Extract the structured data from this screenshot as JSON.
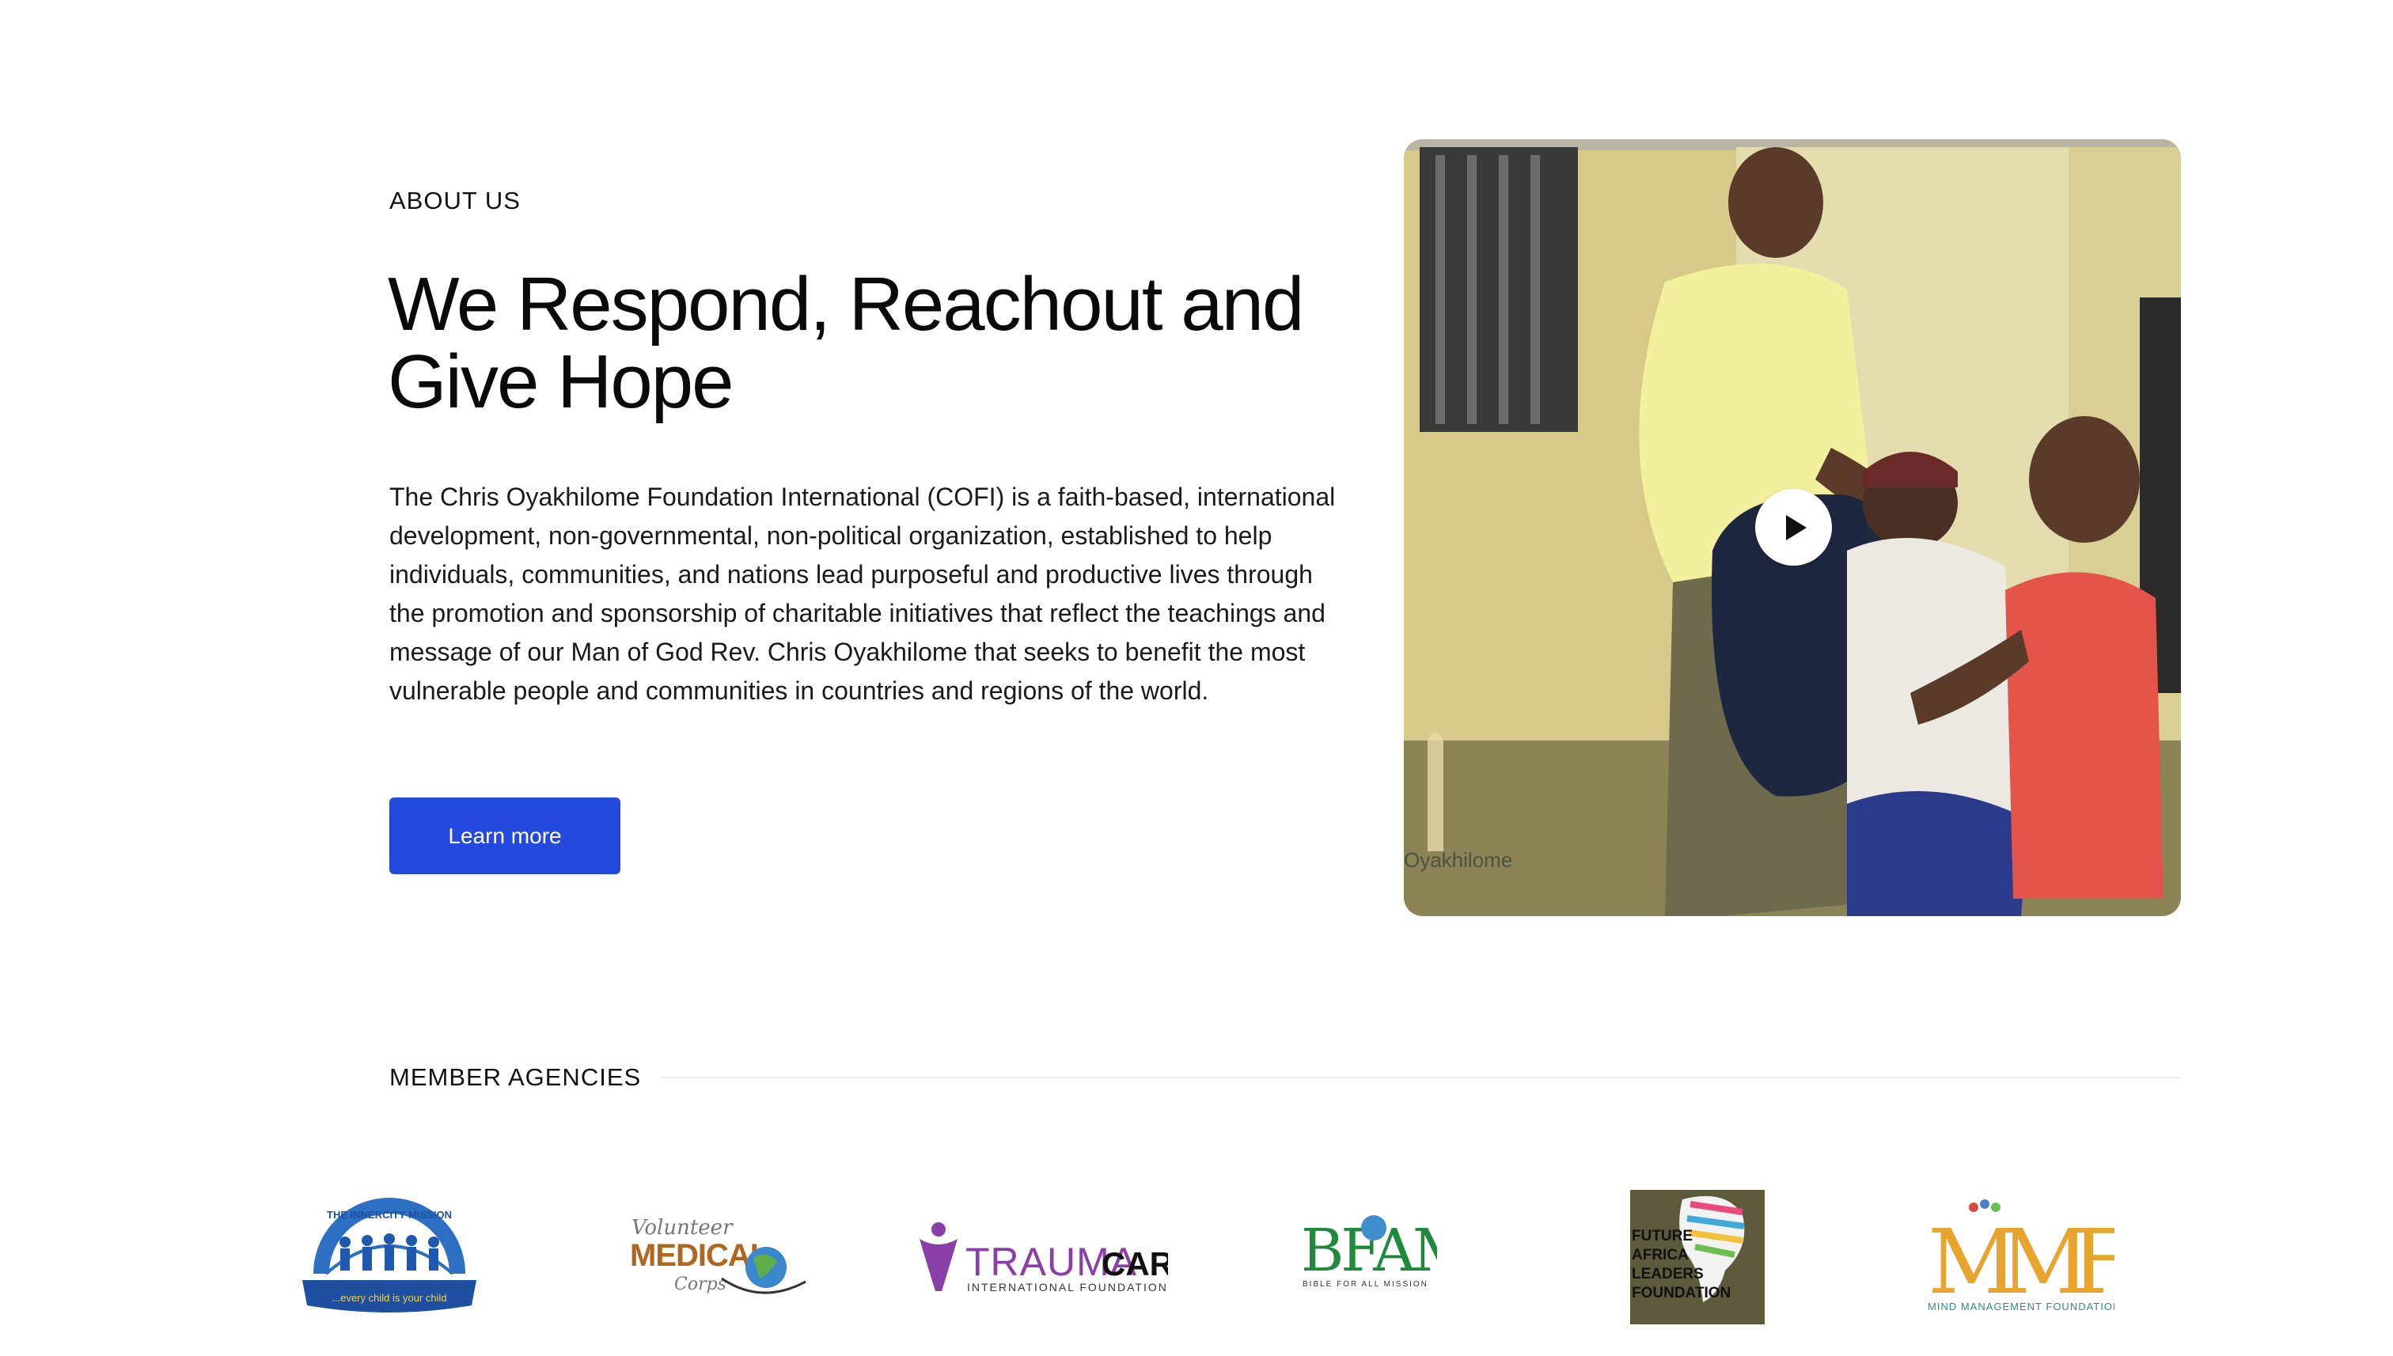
{
  "about": {
    "eyebrow": "ABOUT US",
    "headline": "We Respond, Reachout and Give Hope",
    "body": "The Chris Oyakhilome Foundation International (COFI) is a faith-based, international development, non-governmental, non-political organization, established to help individuals, communities, and nations lead purposeful and productive lives through the promotion and sponsorship of charitable initiatives that reflect the teachings and message of our Man of God Rev. Chris Oyakhilome that seeks to benefit the most vulnerable people and communities in countries and regions of the world.",
    "cta_label": "Learn more"
  },
  "video": {
    "play_icon": "play-icon",
    "watermark": "Oyakhilome"
  },
  "agencies": {
    "label": "MEMBER AGENCIES",
    "logos": {
      "innercity": {
        "arc_text": "THE INNERCITY MISSION",
        "tagline": "...every child is your child"
      },
      "vmc": {
        "script": "Volunteer",
        "main": "MEDICAL",
        "script2": "Corps"
      },
      "trauma": {
        "part1": "TRAUMA",
        "part2": "CARE",
        "sub": "INTERNATIONAL FOUNDATION"
      },
      "bfam": {
        "main": "BFAM",
        "sub": "BIBLE FOR ALL MISSION"
      },
      "fal": {
        "line1": "FUTURE",
        "line2": "AFRICA",
        "line3": "LEADERS",
        "line4": "FOUNDATION"
      },
      "mmf": {
        "main": "MMF",
        "sub": "MIND MANAGEMENT FOUNDATION"
      }
    }
  },
  "colors": {
    "accent": "#2449dd",
    "text": "#111111",
    "divider": "#ececec"
  }
}
